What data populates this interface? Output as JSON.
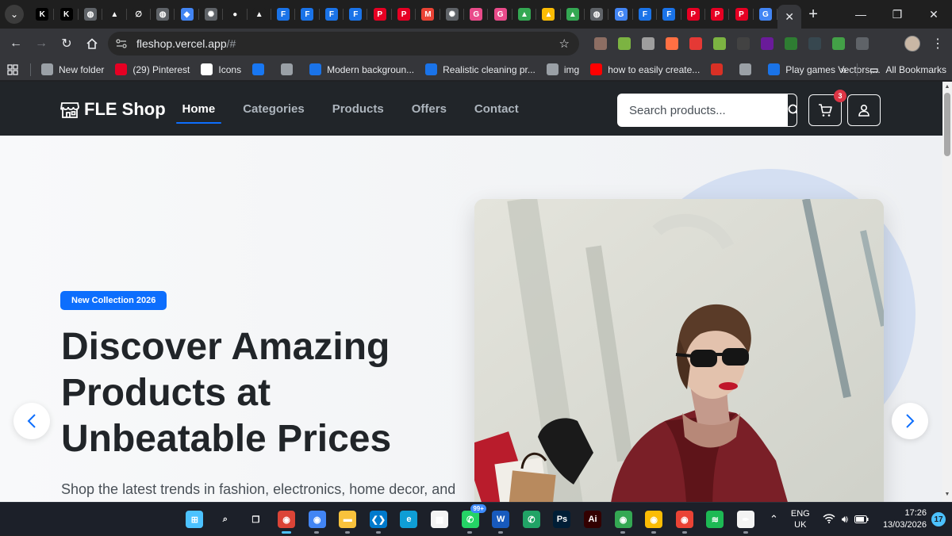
{
  "browser": {
    "pinned_tab_favicons": [
      {
        "icon": "k-icon",
        "glyph": "K",
        "color": "#000000"
      },
      {
        "icon": "k-icon",
        "glyph": "K",
        "color": "#000000"
      },
      {
        "icon": "globe-icon",
        "glyph": "◍",
        "color": "#5f6368"
      },
      {
        "icon": "triangle-logo-icon",
        "glyph": "▲",
        "color": "#1f1f1f"
      },
      {
        "icon": "loop-icon",
        "glyph": "∅",
        "color": "#1f1f1f"
      },
      {
        "icon": "globe-icon",
        "glyph": "◍",
        "color": "#5f6368"
      },
      {
        "icon": "gem-icon",
        "glyph": "◆",
        "color": "#4285f4"
      },
      {
        "icon": "openai-icon",
        "glyph": "✺",
        "color": "#5f6368"
      },
      {
        "icon": "github-icon",
        "glyph": "●",
        "color": "#1f1f1f"
      },
      {
        "icon": "triangle-logo-icon",
        "glyph": "▲",
        "color": "#1f1f1f"
      },
      {
        "icon": "forms-icon",
        "glyph": "F",
        "color": "#1a73e8"
      },
      {
        "icon": "forms-icon",
        "glyph": "F",
        "color": "#1a73e8"
      },
      {
        "icon": "forms-icon",
        "glyph": "F",
        "color": "#1a73e8"
      },
      {
        "icon": "forms-icon",
        "glyph": "F",
        "color": "#1a73e8"
      },
      {
        "icon": "pinterest-icon",
        "glyph": "P",
        "color": "#e60023"
      },
      {
        "icon": "pinterest-icon",
        "glyph": "P",
        "color": "#e60023"
      },
      {
        "icon": "gmail-icon",
        "glyph": "M",
        "color": "#ea4335"
      },
      {
        "icon": "openai-icon",
        "glyph": "✺",
        "color": "#5f6368"
      },
      {
        "icon": "grammarly-icon",
        "glyph": "G",
        "color": "#e94b8a"
      },
      {
        "icon": "grammarly-icon",
        "glyph": "G",
        "color": "#e94b8a"
      },
      {
        "icon": "drive-icon",
        "glyph": "▲",
        "color": "#34a853"
      },
      {
        "icon": "drive-icon",
        "glyph": "▲",
        "color": "#fbbc04"
      },
      {
        "icon": "drive-icon",
        "glyph": "▲",
        "color": "#34a853"
      },
      {
        "icon": "globe-icon",
        "glyph": "◍",
        "color": "#5f6368"
      },
      {
        "icon": "google-icon",
        "glyph": "G",
        "color": "#4285f4"
      },
      {
        "icon": "forms-icon",
        "glyph": "F",
        "color": "#1a73e8"
      },
      {
        "icon": "forms-icon",
        "glyph": "F",
        "color": "#1a73e8"
      },
      {
        "icon": "pinterest-icon",
        "glyph": "P",
        "color": "#e60023"
      },
      {
        "icon": "pinterest-icon",
        "glyph": "P",
        "color": "#e60023"
      },
      {
        "icon": "pinterest-icon",
        "glyph": "P",
        "color": "#e60023"
      },
      {
        "icon": "google-icon",
        "glyph": "G",
        "color": "#4285f4"
      }
    ],
    "active_tab_close": "✕",
    "new_tab": "+",
    "url_host": "fleshop.vercel.app",
    "url_path": "/#",
    "extension_icons": [
      {
        "icon": "eyes-icon",
        "color": "#8d6e63"
      },
      {
        "icon": "chart-icon",
        "color": "#7cb342"
      },
      {
        "icon": "eyedropper-icon",
        "color": "#9e9e9e"
      },
      {
        "icon": "fox-icon",
        "color": "#ff7043"
      },
      {
        "icon": "adblock-icon",
        "color": "#e53935"
      },
      {
        "icon": "chart-icon",
        "color": "#7cb342"
      },
      {
        "icon": "grid-icon",
        "color": "#424242"
      },
      {
        "icon": "p-icon",
        "color": "#6a1b9a"
      },
      {
        "icon": "terminal-icon",
        "color": "#2e7d32"
      },
      {
        "icon": "hash-icon",
        "color": "#37474f"
      },
      {
        "icon": "color-picker-icon",
        "color": "#43a047"
      },
      {
        "icon": "puzzle-icon",
        "color": "#5f6368"
      }
    ],
    "bookmarks": [
      {
        "label": "New folder",
        "icon": "folder-icon",
        "color": "#9aa0a6"
      },
      {
        "label": "(29) Pinterest",
        "icon": "pinterest-icon",
        "color": "#e60023"
      },
      {
        "label": "Icons",
        "icon": "notion-icon",
        "color": "#ffffff"
      },
      {
        "label": "",
        "icon": "facebook-icon",
        "color": "#1877f2"
      },
      {
        "label": "",
        "icon": "globe-icon",
        "color": "#9aa0a6"
      },
      {
        "label": "Modern backgroun...",
        "icon": "forms-icon",
        "color": "#1a73e8"
      },
      {
        "label": "Realistic cleaning pr...",
        "icon": "forms-icon",
        "color": "#1a73e8"
      },
      {
        "label": "img",
        "icon": "globe-icon",
        "color": "#9aa0a6"
      },
      {
        "label": "how to easily create...",
        "icon": "youtube-icon",
        "color": "#ff0000"
      },
      {
        "label": "",
        "icon": "mic-icon",
        "color": "#d93025"
      },
      {
        "label": "",
        "icon": "globe-icon",
        "color": "#9aa0a6"
      },
      {
        "label": "Play games Vectors,...",
        "icon": "forms-icon",
        "color": "#1a73e8"
      }
    ],
    "bookmarks_overflow": "»",
    "all_bookmarks": "All Bookmarks"
  },
  "site": {
    "brand": "FLE Shop",
    "nav": [
      {
        "label": "Home",
        "active": true
      },
      {
        "label": "Categories",
        "active": false
      },
      {
        "label": "Products",
        "active": false
      },
      {
        "label": "Offers",
        "active": false
      },
      {
        "label": "Contact",
        "active": false
      }
    ],
    "search_placeholder": "Search products...",
    "cart_count": "3",
    "accent": "#0d6efd",
    "navbar_bg": "#212529"
  },
  "hero": {
    "badge": "New Collection 2026",
    "title": "Discover Amazing Products at Unbeatable Prices",
    "subtitle": "Shop the latest trends in fashion, electronics, home decor, and more."
  },
  "taskbar": {
    "apps": [
      {
        "icon": "windows-start-icon",
        "glyph": "⊞",
        "color": "#4cc2ff",
        "running": false
      },
      {
        "icon": "search-icon",
        "glyph": "⌕",
        "color": "transparent",
        "running": false
      },
      {
        "icon": "task-view-icon",
        "glyph": "❐",
        "color": "transparent",
        "running": false
      },
      {
        "icon": "chrome-icon",
        "glyph": "◉",
        "color": "#db4437",
        "running": true,
        "active": true
      },
      {
        "icon": "chrome-icon",
        "glyph": "◉",
        "color": "#4285f4",
        "running": true
      },
      {
        "icon": "file-explorer-icon",
        "glyph": "▬",
        "color": "#f9c23c",
        "running": true
      },
      {
        "icon": "vscode-icon",
        "glyph": "❮❯",
        "color": "#007acc",
        "running": true
      },
      {
        "icon": "edge-icon",
        "glyph": "e",
        "color": "#0f9ed5",
        "running": false
      },
      {
        "icon": "ms-store-icon",
        "glyph": "▦",
        "color": "#f3f3f3",
        "running": false
      },
      {
        "icon": "whatsapp-icon",
        "glyph": "✆",
        "color": "#25d366",
        "running": true,
        "badge": "99+"
      },
      {
        "icon": "word-icon",
        "glyph": "W",
        "color": "#185abd",
        "running": true
      },
      {
        "icon": "phone-link-icon",
        "glyph": "✆",
        "color": "#21a366",
        "running": false
      },
      {
        "icon": "photoshop-icon",
        "glyph": "Ps",
        "color": "#001e36",
        "running": false
      },
      {
        "icon": "illustrator-icon",
        "glyph": "Ai",
        "color": "#330000",
        "running": false
      },
      {
        "icon": "chrome-icon",
        "glyph": "◉",
        "color": "#34a853",
        "running": true
      },
      {
        "icon": "chrome-icon",
        "glyph": "◉",
        "color": "#fbbc04",
        "running": true
      },
      {
        "icon": "chrome-icon",
        "glyph": "◉",
        "color": "#ea4335",
        "running": true
      },
      {
        "icon": "spotify-icon",
        "glyph": "≋",
        "color": "#1db954",
        "running": false
      },
      {
        "icon": "pen-app-icon",
        "glyph": "✒",
        "color": "#f3f3f3",
        "running": true
      }
    ],
    "lang_top": "ENG",
    "lang_bottom": "UK",
    "time": "17:26",
    "date": "13/03/2026",
    "notifications": "17"
  }
}
